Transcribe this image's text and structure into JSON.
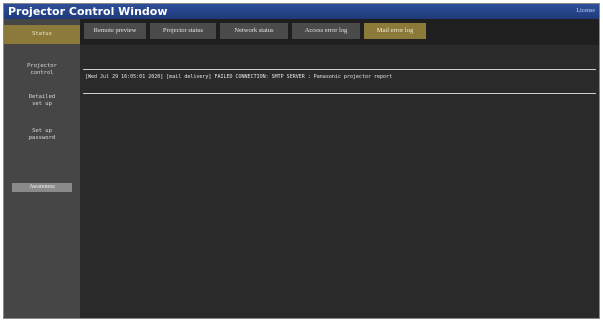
{
  "window": {
    "title": "Projector Control Window",
    "license_link": "License"
  },
  "sidebar": {
    "items": [
      {
        "label": "Status",
        "active": true
      },
      {
        "label": "Projector\ncontrol",
        "active": false
      },
      {
        "label": "Detailed\nset up",
        "active": false
      },
      {
        "label": "Set up\npassword",
        "active": false
      }
    ],
    "extra_button": "Awareness"
  },
  "tabs": [
    {
      "label": "Remote preview",
      "active": false
    },
    {
      "label": "Projector status",
      "active": false
    },
    {
      "label": "Network status",
      "active": false
    },
    {
      "label": "Access error log",
      "active": false
    },
    {
      "label": "Mail error log",
      "active": true
    }
  ],
  "log": {
    "entries": [
      "[Wed Jul 29 16:05:01 2020] [mail delivery] FAILED CONNECTION: SMTP SERVER : Panasonic projector report"
    ]
  },
  "colors": {
    "active_gold": "#8c7a3a",
    "title_bar": "#2d4f99",
    "background": "#2a2a2a"
  }
}
